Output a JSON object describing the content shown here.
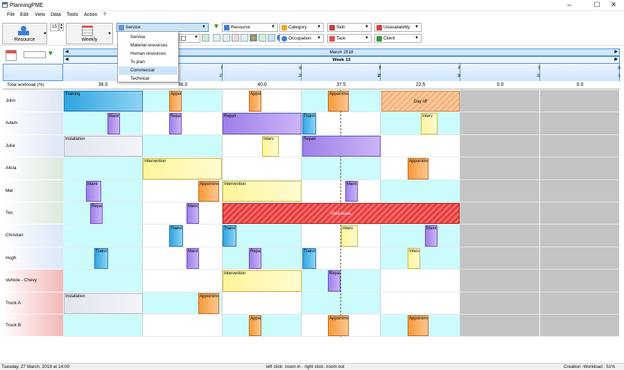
{
  "app": {
    "title": "PlanningPME"
  },
  "menu": [
    "File",
    "Edit",
    "View",
    "Data",
    "Tools",
    "Action",
    "?"
  ],
  "toolbar": {
    "resource_label": "Resource",
    "zoom_value": "15",
    "view_label": "Weekly",
    "service_select": "Service",
    "filters": {
      "resource": "Resource",
      "category": "Category",
      "skill": "Skill",
      "unavailability": "Unavailability",
      "occupation": "Occupation",
      "task": "Task",
      "client": "Client"
    }
  },
  "dropdown": {
    "options": [
      "Service",
      "Material resources",
      "Human resources",
      "To plan",
      "Commercial",
      "Technical"
    ],
    "selected_index": 4
  },
  "calendar": {
    "month": "March 2018",
    "week": "Week 13",
    "days": [
      {
        "l": "M",
        "n": "26"
      },
      {
        "l": "T",
        "n": "27"
      },
      {
        "l": "W",
        "n": "28"
      },
      {
        "l": "T",
        "n": "29"
      },
      {
        "l": "F",
        "n": "30"
      },
      {
        "l": "S",
        "n": "31"
      },
      {
        "l": "S",
        "n": "1"
      }
    ],
    "workload_label": "Total workload (%)",
    "workload": [
      "36.0",
      "36.0",
      "40.0",
      "37.5",
      "22.5",
      "0.0",
      "0.0"
    ]
  },
  "resources": [
    "John",
    "Adam",
    "Julia",
    "Alicia",
    "Mel",
    "Tim",
    "Christian",
    "Hugh",
    "Vehicle - Chevy",
    "Truck A",
    "Truck B"
  ],
  "task_labels": {
    "training": "Training",
    "appointment": "Appointment",
    "appoi": "Appoi",
    "day_off": "Day off",
    "maint": "Maint",
    "repair": "Repair",
    "interv": "Interv",
    "installation": "Installation",
    "intervention": "Intervention",
    "paid_leave": "Paid leave",
    "trainin": "Training"
  },
  "status": {
    "left": "Tuesday, 27 March, 2018 at 14:00",
    "center": "left click: zoom in - right click: zoom out",
    "right": "Creation -Workload : 51%"
  },
  "colors": {
    "header_blue": "#cfe6ff",
    "cell_cyan": "#ccfbfb",
    "weekend_gray": "#c4c4c4",
    "accent": "#4a8ed8"
  }
}
